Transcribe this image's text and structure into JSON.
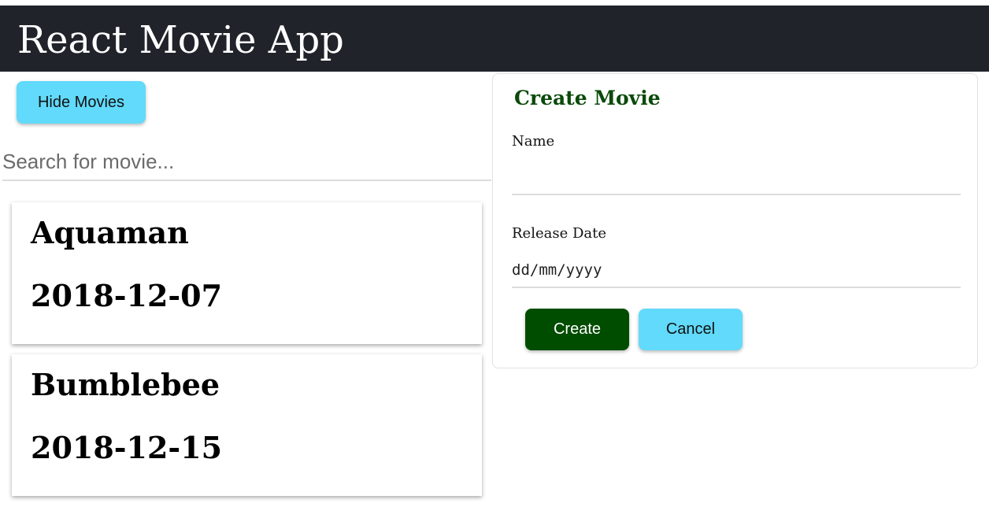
{
  "header": {
    "title": "React Movie App",
    "background": "#20232a"
  },
  "toolbar": {
    "hide_movies_label": "Hide Movies"
  },
  "search": {
    "placeholder": "Search for movie...",
    "value": ""
  },
  "movies": [
    {
      "name": "Aquaman",
      "release_date": "2018-12-07"
    },
    {
      "name": "Bumblebee",
      "release_date": "2018-12-15"
    }
  ],
  "create_form": {
    "title": "Create Movie",
    "name_label": "Name",
    "name_value": "",
    "release_date_label": "Release Date",
    "release_date_placeholder": "dd/mm/yyyy",
    "create_label": "Create",
    "cancel_label": "Cancel"
  },
  "colors": {
    "accent": "#61dafb",
    "primary": "#004d00",
    "title_green": "#0a4a0a"
  }
}
